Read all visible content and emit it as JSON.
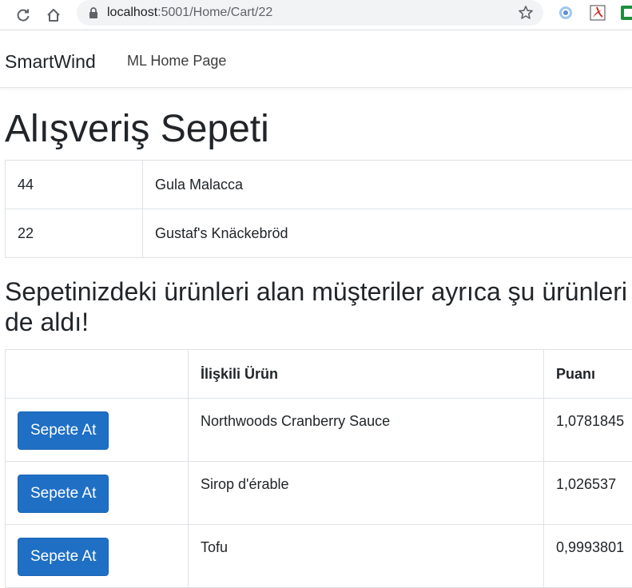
{
  "browser": {
    "url_host": "localhost",
    "url_path": ":5001/Home/Cart/22"
  },
  "navbar": {
    "brand": "SmartWind",
    "links": [
      {
        "label": "ML Home Page"
      }
    ]
  },
  "page": {
    "title": "Alışveriş Sepeti"
  },
  "cart": {
    "rows": [
      {
        "quantity": "44",
        "product": "Gula Malacca"
      },
      {
        "quantity": "22",
        "product": "Gustaf's Knäckebröd"
      }
    ]
  },
  "recommendations": {
    "heading": "Sepetinizdeki ürünleri alan müşteriler ayrıca şu ürünleri de aldı!",
    "columns": [
      "",
      "İlişkili Ürün",
      "Puanı"
    ],
    "button_label": "Sepete At",
    "rows": [
      {
        "product": "Northwoods Cranberry Sauce",
        "score": "1,0781845"
      },
      {
        "product": "Sirop d'érable",
        "score": "1,026537"
      },
      {
        "product": "Tofu",
        "score": "0,9993801"
      }
    ]
  },
  "colors": {
    "primary_button": "#1f6fc5",
    "table_border": "#dee2e6"
  }
}
